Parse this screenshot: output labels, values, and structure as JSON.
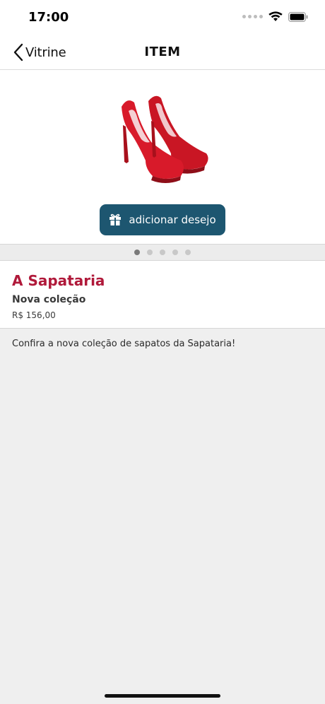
{
  "status_bar": {
    "time": "17:00"
  },
  "nav": {
    "back_label": "Vitrine",
    "title": "ITEM"
  },
  "product": {
    "image_icon": "red-high-heel-shoes",
    "wish_button_label": "adicionar desejo",
    "wish_icon": "gift-icon",
    "pager": {
      "total": 5,
      "active_index": 0
    }
  },
  "info": {
    "store_name": "A Sapataria",
    "subtitle": "Nova coleção",
    "price": "R$  156,00"
  },
  "description": "Confira a nova coleção de sapatos da Sapataria!",
  "colors": {
    "accent": "#1d5670",
    "brand": "#b0193a",
    "background": "#efefef"
  }
}
